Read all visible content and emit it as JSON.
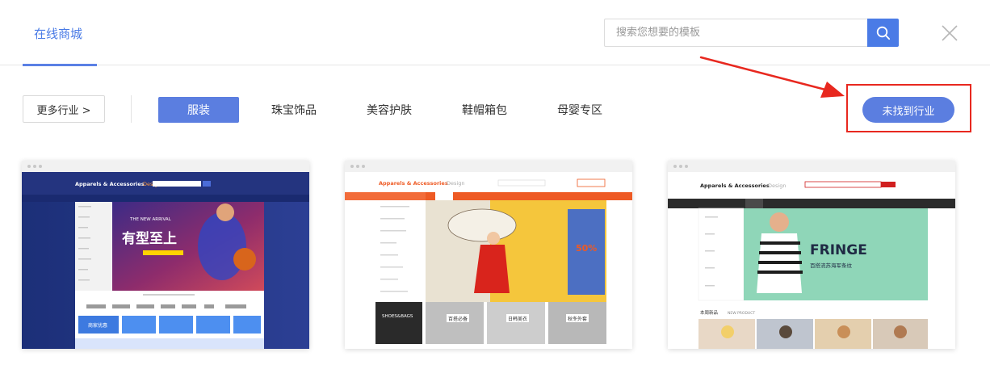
{
  "header": {
    "tab_label": "在线商城",
    "search_placeholder": "搜索您想要的模板"
  },
  "filters": {
    "more_label": "更多行业 >",
    "categories": [
      "服装",
      "珠宝饰品",
      "美容护肤",
      "鞋帽箱包",
      "母婴专区"
    ],
    "active_index": 0,
    "not_found_label": "未找到行业"
  },
  "templates": [
    {
      "logo": "Apparels & Accessories",
      "logo_suffix": "Design",
      "banner_en": "THE NEW ARRIVAL",
      "banner_cn": "有型至上",
      "sub_banner": "商家优惠"
    },
    {
      "logo": "Apparels & Accessories",
      "logo_suffix": "Design",
      "badge": "50%",
      "tiles": [
        "SHOES&BAGS",
        "百搭必备",
        "日韩美衣",
        "秋冬外套"
      ]
    },
    {
      "logo": "Apparels & Accessories",
      "logo_suffix": "Design",
      "banner_en": "FRINGE",
      "banner_cn": "百搭流苏海军条纹",
      "section_title": "本周新品",
      "section_sub": "NEW PRODUCT"
    }
  ],
  "colors": {
    "accent": "#5b7ee0",
    "search_button": "#4a7be6",
    "annotation_red": "#e8281f"
  }
}
